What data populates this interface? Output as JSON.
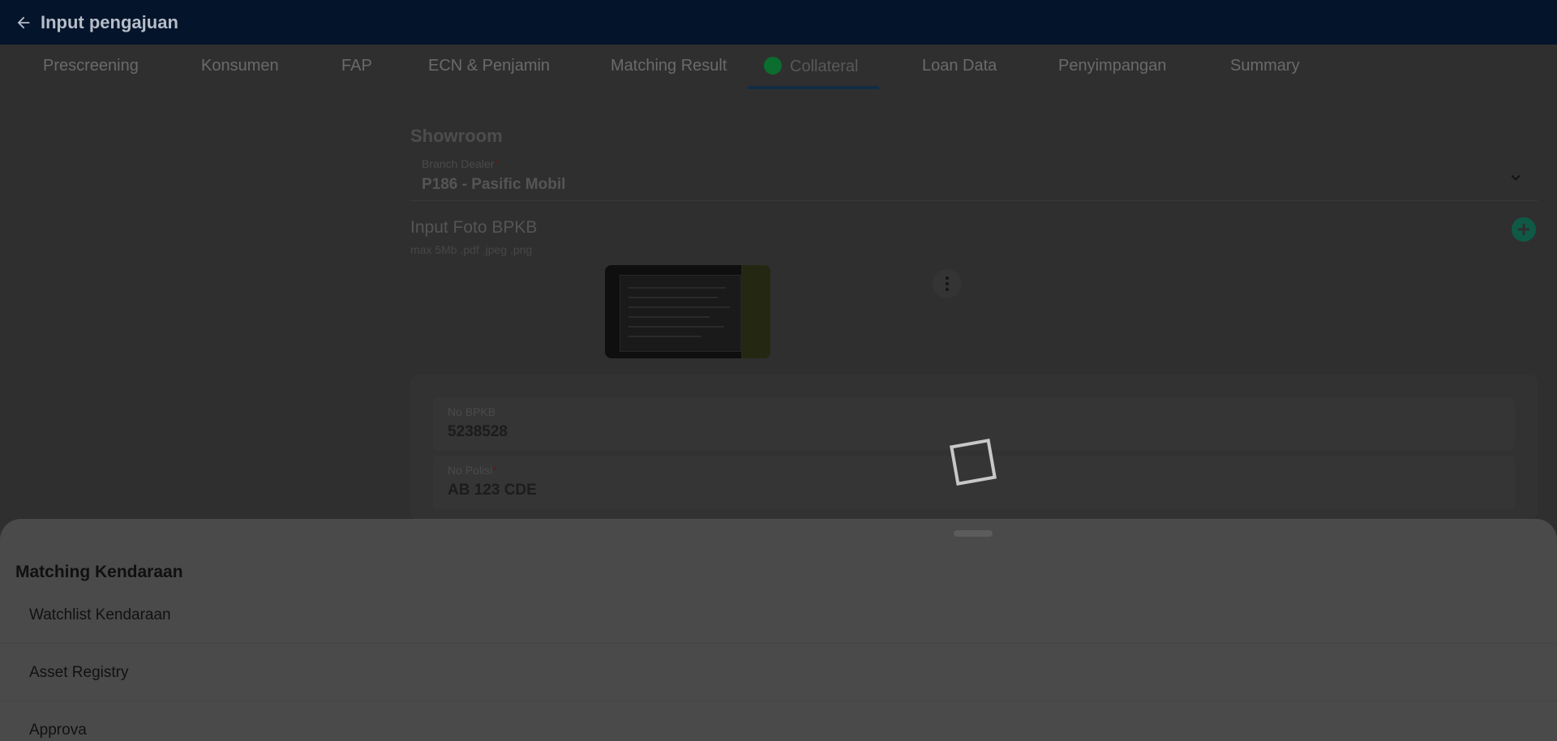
{
  "appbar": {
    "title": "Input pengajuan",
    "back_icon": "arrow-left-icon"
  },
  "tabs": [
    {
      "label": "Prescreening"
    },
    {
      "label": "Konsumen"
    },
    {
      "label": "FAP"
    },
    {
      "label": "ECN & Penjamin"
    },
    {
      "label": "Matching Result"
    },
    {
      "label": "Collateral",
      "active": true,
      "status_color": "#0b6d2e"
    },
    {
      "label": "Loan Data"
    },
    {
      "label": "Penyimpangan"
    },
    {
      "label": "Summary"
    }
  ],
  "showroom": {
    "title": "Showroom",
    "branch_label": "Branch Dealer",
    "branch_required": "*",
    "branch_value": "P186 - Pasific Mobil"
  },
  "foto_bpkb": {
    "title": "Input Foto BPKB",
    "hint": "max 5Mb .pdf .jpeg .png"
  },
  "vehicle": {
    "no_bpkb_label": "No BPKB",
    "no_bpkb_value": "5238528",
    "no_polisi_label": "No Polisi",
    "no_polisi_required": "*",
    "no_polisi_value": "AB 123 CDE"
  },
  "sheet": {
    "title": "Matching Kendaraan",
    "items": [
      {
        "label": "Watchlist Kendaraan"
      },
      {
        "label": "Asset Registry"
      },
      {
        "label": "Approva"
      }
    ]
  },
  "colors": {
    "appbar": "#04142b",
    "accent_green": "#0b6d2e",
    "add_button": "#0f5a46",
    "sheet": "#4a4a4a"
  }
}
